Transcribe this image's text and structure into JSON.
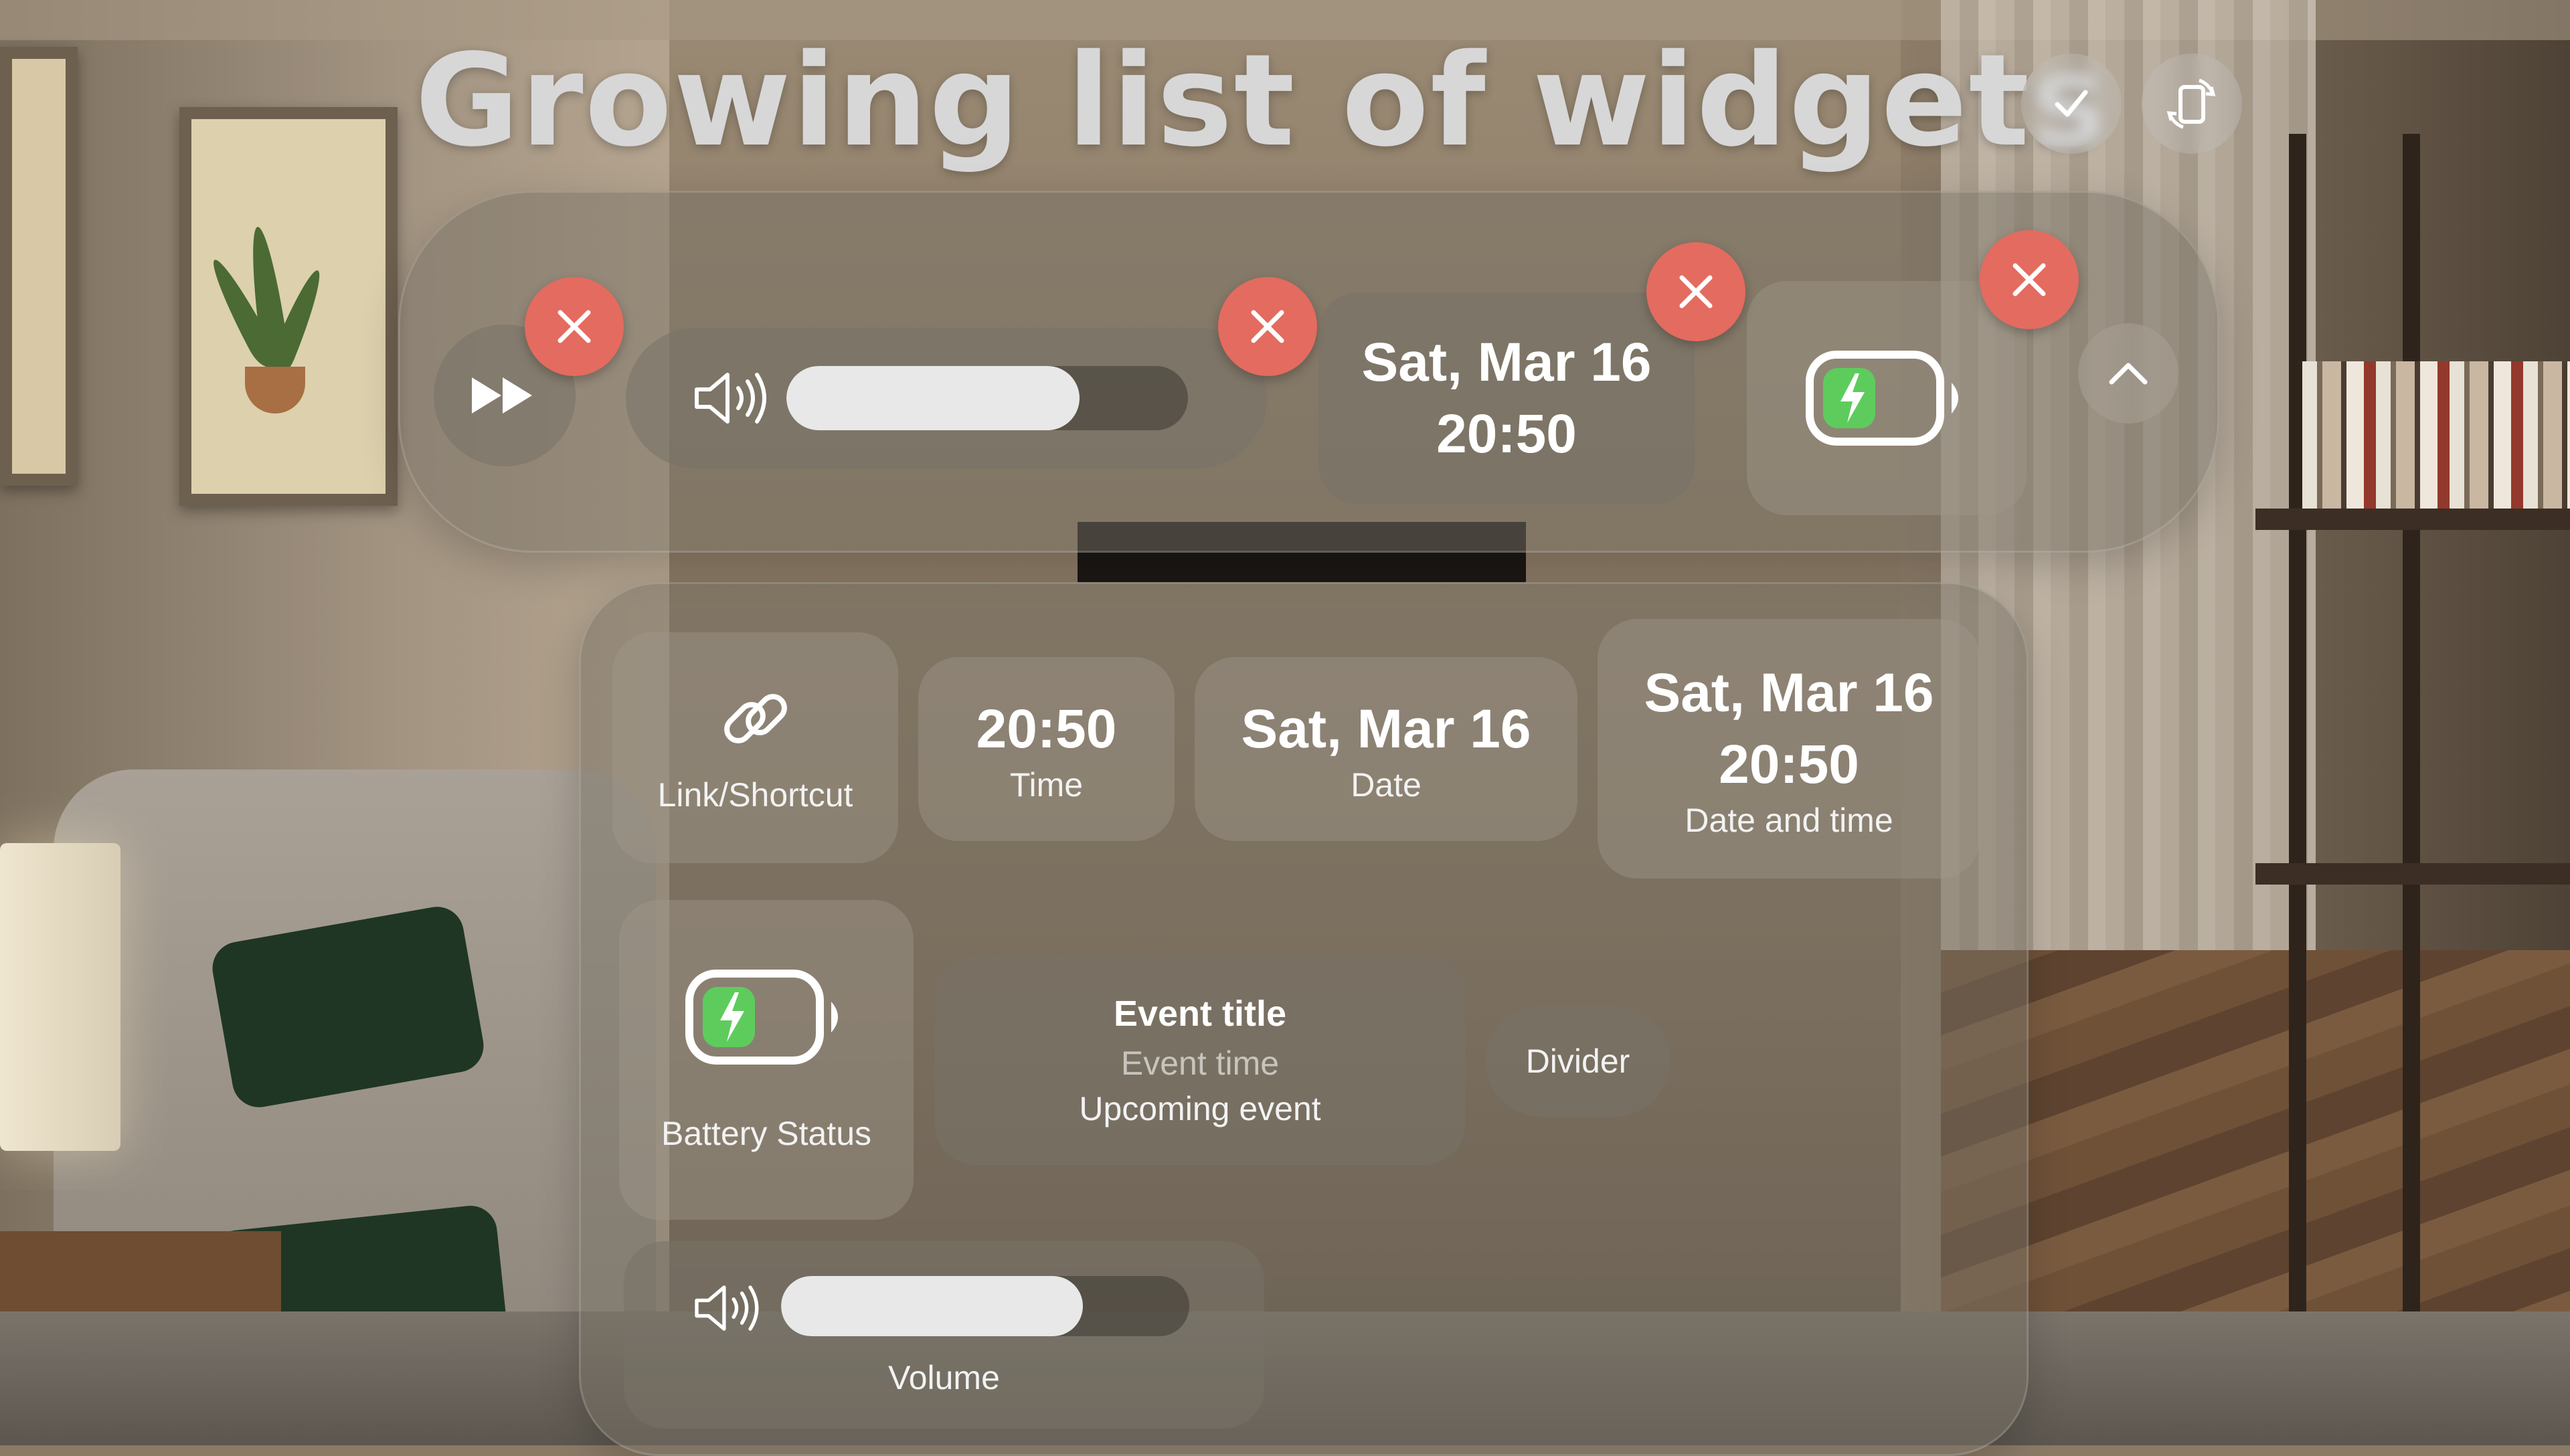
{
  "title": "Growing list of widgets",
  "top_buttons": {
    "left_icon": "checkmark-icon",
    "right_icon": "rotate-device-icon"
  },
  "active_bar": {
    "media_icon": "fast-forward-icon",
    "volume": {
      "icon": "speaker-icon",
      "level": 0.73
    },
    "datetime": {
      "date": "Sat, Mar 16",
      "time": "20:50"
    },
    "battery": {
      "icon": "battery-charging-icon",
      "level": 0.5
    },
    "collapse_icon": "chevron-up-icon",
    "remove_icon": "close-icon"
  },
  "library": {
    "link": {
      "icon": "link-icon",
      "label": "Link/Shortcut"
    },
    "time": {
      "value": "20:50",
      "label": "Time"
    },
    "date": {
      "value": "Sat, Mar 16",
      "label": "Date"
    },
    "date_time": {
      "date": "Sat, Mar 16",
      "time": "20:50",
      "label": "Date and time"
    },
    "battery": {
      "icon": "battery-charging-icon",
      "label": "Battery Status",
      "level": 0.5
    },
    "event": {
      "title": "Event title",
      "time": "Event time",
      "label": "Upcoming event"
    },
    "divider": {
      "label": "Divider"
    },
    "volume": {
      "icon": "speaker-icon",
      "label": "Volume",
      "level": 0.74
    }
  },
  "colors": {
    "close_red": "#e46b5f",
    "battery_green": "#5dcc5d"
  }
}
